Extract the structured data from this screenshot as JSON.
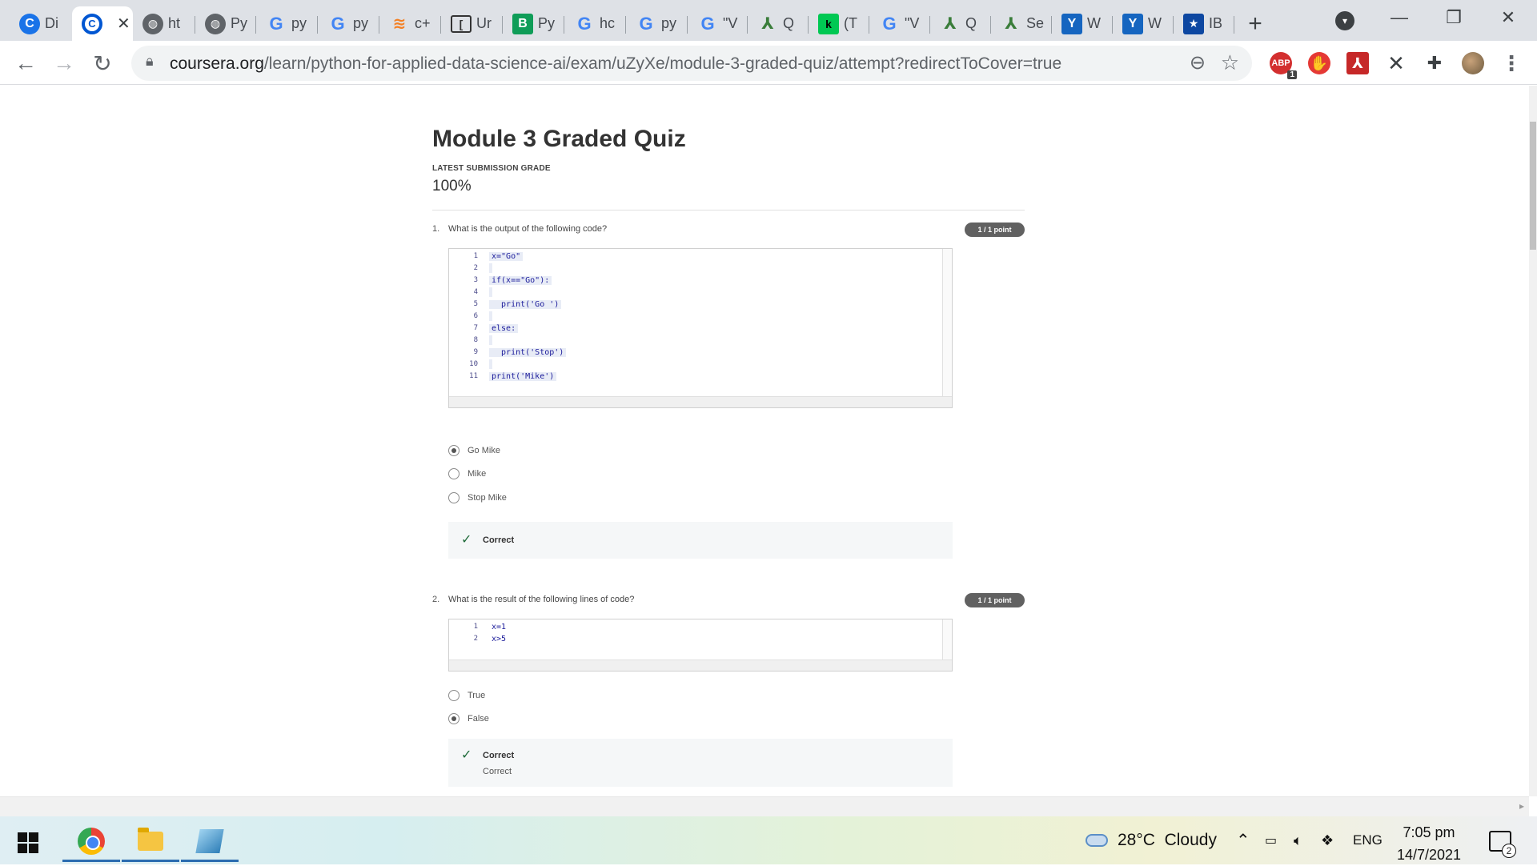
{
  "browser": {
    "tabs": [
      {
        "label": "Di",
        "icon": "coursera-icon",
        "active": false
      },
      {
        "label": "",
        "icon": "coursera-icon",
        "active": true
      },
      {
        "label": "ht",
        "icon": "globe-icon",
        "active": false
      },
      {
        "label": "Py",
        "icon": "globe-icon",
        "active": false
      },
      {
        "label": "py",
        "icon": "google-icon",
        "active": false
      },
      {
        "label": "py",
        "icon": "google-icon",
        "active": false
      },
      {
        "label": "c+",
        "icon": "stackoverflow-icon",
        "active": false
      },
      {
        "label": "Ur",
        "icon": "datacamp-icon",
        "active": false
      },
      {
        "label": "Py",
        "icon": "b-icon",
        "active": false
      },
      {
        "label": "hc",
        "icon": "google-icon",
        "active": false
      },
      {
        "label": "py",
        "icon": "google-icon",
        "active": false
      },
      {
        "label": "\"V",
        "icon": "google-icon",
        "active": false
      },
      {
        "label": "Q",
        "icon": "quora-icon",
        "active": false
      },
      {
        "label": "(T",
        "icon": "green-icon",
        "active": false
      },
      {
        "label": "\"V",
        "icon": "google-icon",
        "active": false
      },
      {
        "label": "Q",
        "icon": "quora-icon",
        "active": false
      },
      {
        "label": "Se",
        "icon": "quora-icon",
        "active": false
      },
      {
        "label": "W",
        "icon": "y-icon",
        "active": false
      },
      {
        "label": "W",
        "icon": "y-icon",
        "active": false
      },
      {
        "label": "IB",
        "icon": "star-icon",
        "active": false
      }
    ],
    "url_host": "coursera.org",
    "url_path": "/learn/python-for-applied-data-science-ai/exam/uZyXe/module-3-graded-quiz/attempt?redirectToCover=true",
    "abp_count": "1"
  },
  "quiz": {
    "title": "Module 3 Graded Quiz",
    "grade_label": "LATEST SUBMISSION GRADE",
    "grade_value": "100%",
    "questions": [
      {
        "number": "1.",
        "text": "What is the output of the following code?",
        "points": "1 / 1 point",
        "code": [
          {
            "n": "1",
            "text": "x=\"Go\""
          },
          {
            "n": "2",
            "text": ""
          },
          {
            "n": "3",
            "text": "if(x==\"Go\"):"
          },
          {
            "n": "4",
            "text": ""
          },
          {
            "n": "5",
            "text": "  print('Go ')"
          },
          {
            "n": "6",
            "text": ""
          },
          {
            "n": "7",
            "text": "else:"
          },
          {
            "n": "8",
            "text": ""
          },
          {
            "n": "9",
            "text": "  print('Stop')"
          },
          {
            "n": "10",
            "text": ""
          },
          {
            "n": "11",
            "text": "print('Mike')"
          }
        ],
        "options": [
          {
            "label": "Go Mike",
            "selected": true
          },
          {
            "label": "Mike",
            "selected": false
          },
          {
            "label": "Stop Mike",
            "selected": false
          }
        ],
        "feedback_title": "Correct",
        "feedback_text": ""
      },
      {
        "number": "2.",
        "text": "What is the result of the following lines of code?",
        "points": "1 / 1 point",
        "code": [
          {
            "n": "1",
            "text": "x=1"
          },
          {
            "n": "2",
            "text": "x>5"
          }
        ],
        "options": [
          {
            "label": "True",
            "selected": false
          },
          {
            "label": "False",
            "selected": true
          }
        ],
        "feedback_title": "Correct",
        "feedback_text": "Correct"
      }
    ]
  },
  "taskbar": {
    "weather": "28°C  Cloudy",
    "language": "ENG",
    "time": "7:05 pm",
    "date": "14/7/2021",
    "notifications": "2"
  }
}
